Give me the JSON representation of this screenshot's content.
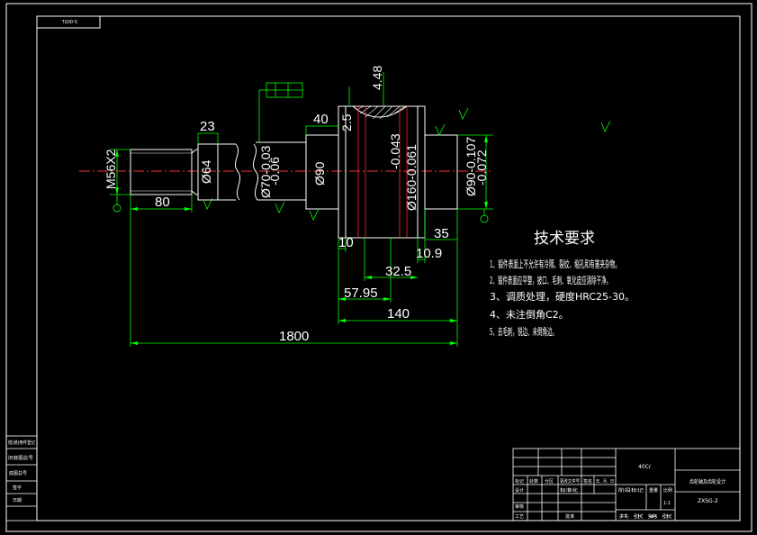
{
  "drawing_code_top": "S-005L",
  "dimensions": {
    "d1": "4.48",
    "d2": "23",
    "d3": "40",
    "d4": "2.5",
    "d5": "M56X2",
    "d6": "Ø64",
    "d7": "Ø70-0.03",
    "d7b": "-0.06",
    "d8": "Ø90",
    "d9": "-0.043",
    "d10": "Ø160-0.061",
    "d11": "Ø90-0.107",
    "d11b": "-0.072",
    "d12": "80",
    "d13": "35",
    "d14": "10",
    "d15": "10.9",
    "d16": "32.5",
    "d17": "57.95",
    "d18": "140",
    "d19": "1800"
  },
  "tech": {
    "title": "技术要求",
    "items": [
      "1、锻件表面上不允许有冷隔、裂纹、缩孔和有害夹杂物。",
      "2、锻件表面应平整，披口、毛刺、氧化皮应清除干净。",
      "3、调质处理，硬度HRC25-30。",
      "4、未注倒角C2。",
      "5、去毛刺，锐边、未倒角边。"
    ]
  },
  "left_strip": [
    "借(通)用件登记",
    "旧底图总号",
    "底图总号",
    "签字",
    "日期"
  ],
  "title_block": {
    "material": "40Cr",
    "part_name": "齿轮轴及齿轮设计",
    "drawing_no": "ZXSG-2",
    "row_labels": [
      "标记",
      "处数",
      "分区",
      "更改文件号",
      "签名",
      "年、月、日"
    ],
    "designer": "设计",
    "standard": "标准化",
    "checker": "审核",
    "approver": "工艺",
    "approve2": "批准",
    "stage": "阶段标记",
    "weight": "重量",
    "scale": "比例",
    "scale_value": "1:1",
    "sheet": "共 张 第 张"
  }
}
